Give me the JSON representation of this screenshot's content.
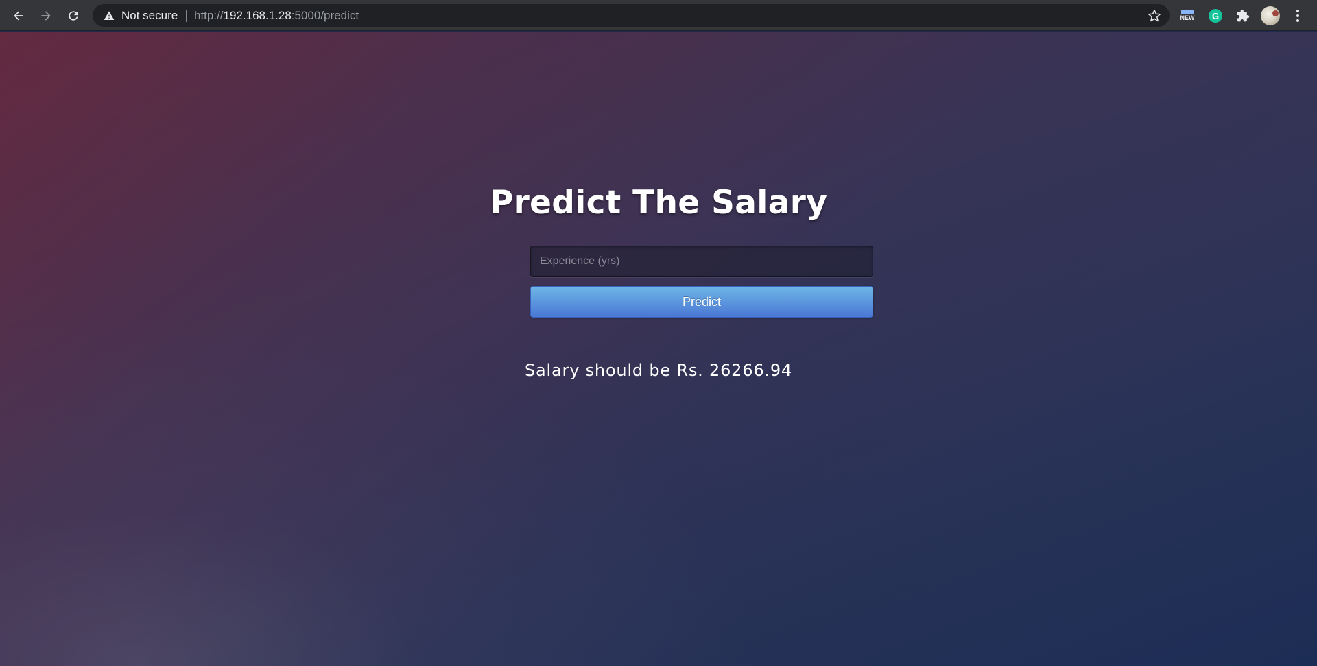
{
  "browser": {
    "security_label": "Not secure",
    "url_scheme": "http://",
    "url_host": "192.168.1.28",
    "url_path": ":5000/predict",
    "extensions": {
      "new_badge": "NEW",
      "grammarly_letter": "G"
    },
    "icons": [
      "back-arrow-icon",
      "forward-arrow-icon",
      "reload-icon",
      "warning-icon",
      "star-icon",
      "puzzle-icon",
      "kebab-menu-icon"
    ]
  },
  "page": {
    "title": "Predict The Salary",
    "input_placeholder": "Experience (yrs)",
    "input_value": "",
    "predict_label": "Predict",
    "result_text": "Salary should be Rs. 26266.94"
  },
  "colors": {
    "button_top": "#6eb6e6",
    "button_bottom": "#4a77d4",
    "text": "#ffffff"
  }
}
